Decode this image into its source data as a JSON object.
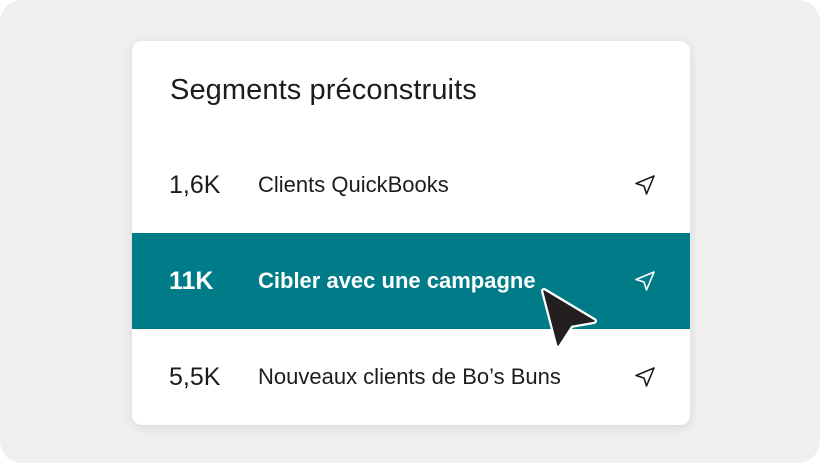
{
  "card": {
    "title": "Segments préconstruits"
  },
  "segments": [
    {
      "count": "1,6K",
      "label": "Clients QuickBooks",
      "icon": "send-icon",
      "active": false
    },
    {
      "count": "11K",
      "label": "Cibler avec une campagne",
      "icon": "send-icon",
      "active": true
    },
    {
      "count": "5,5K",
      "label": "Nouveaux clients de Bo’s Buns",
      "icon": "send-icon",
      "active": false
    }
  ],
  "colors": {
    "accent": "#007c89",
    "background": "#efefef",
    "card": "#ffffff",
    "text": "#1c1c1c"
  }
}
